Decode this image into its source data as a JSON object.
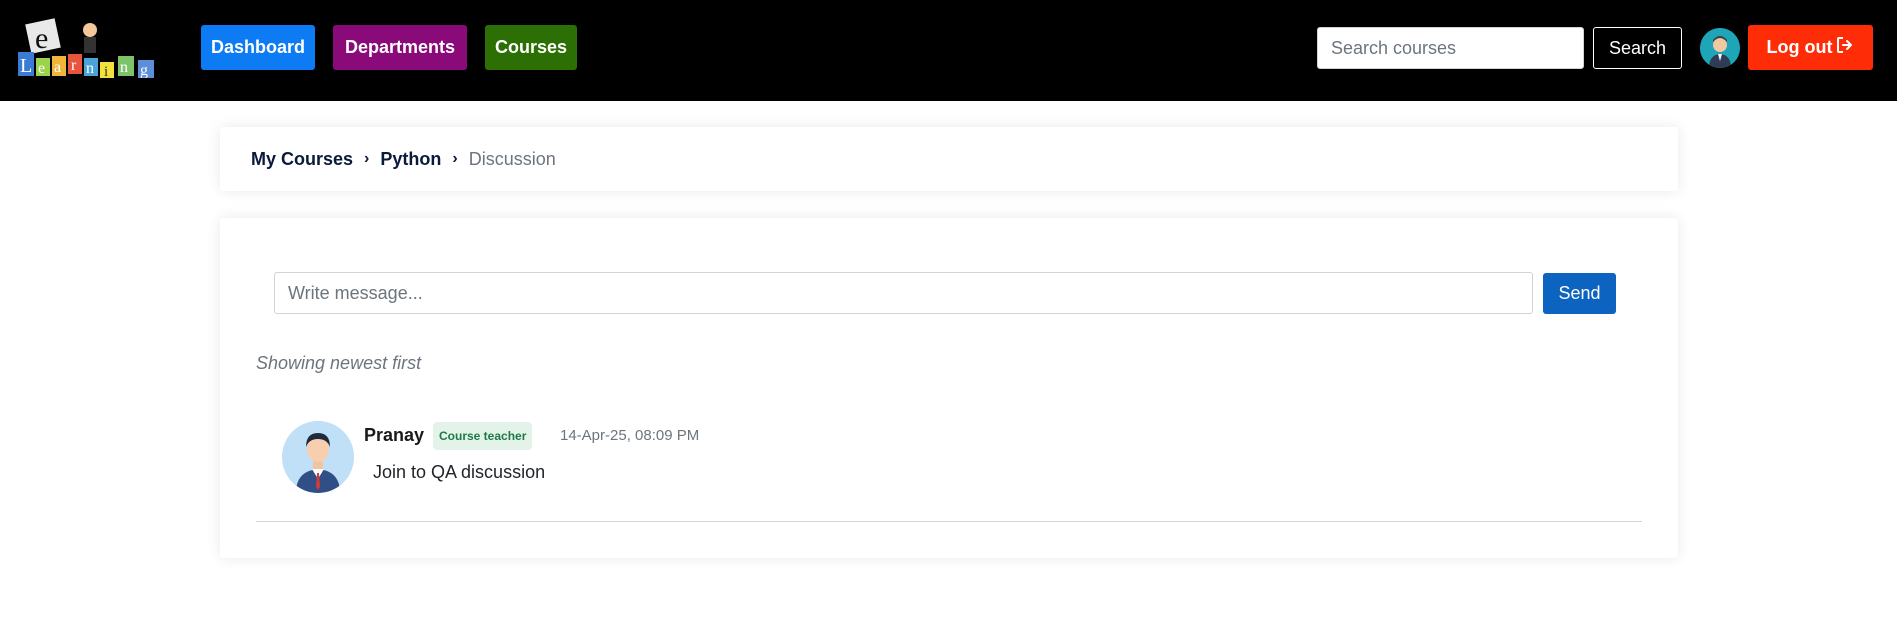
{
  "header": {
    "logo_text": "eLearning",
    "nav": {
      "dashboard": "Dashboard",
      "departments": "Departments",
      "courses": "Courses"
    },
    "search": {
      "placeholder": "Search courses",
      "value": "",
      "button": "Search"
    },
    "logout": "Log out",
    "colors": {
      "dashboard": "#0d7bf4",
      "departments": "#8b0a7a",
      "courses": "#2c7005",
      "logout": "#ff2d07"
    }
  },
  "breadcrumb": {
    "items": [
      "My Courses",
      "Python"
    ],
    "current": "Discussion"
  },
  "discussion": {
    "input_placeholder": "Write message...",
    "input_value": "",
    "send": "Send",
    "sort_note": "Showing newest first",
    "messages": [
      {
        "author": "Pranay",
        "badge": "Course teacher",
        "time": "14-Apr-25, 08:09 PM",
        "text": "Join to QA discussion"
      }
    ]
  },
  "icons": {
    "logo": "elearning-logo",
    "user_avatar": "user-avatar-icon",
    "logout": "sign-out-icon",
    "chevron": "chevron-right-icon"
  }
}
